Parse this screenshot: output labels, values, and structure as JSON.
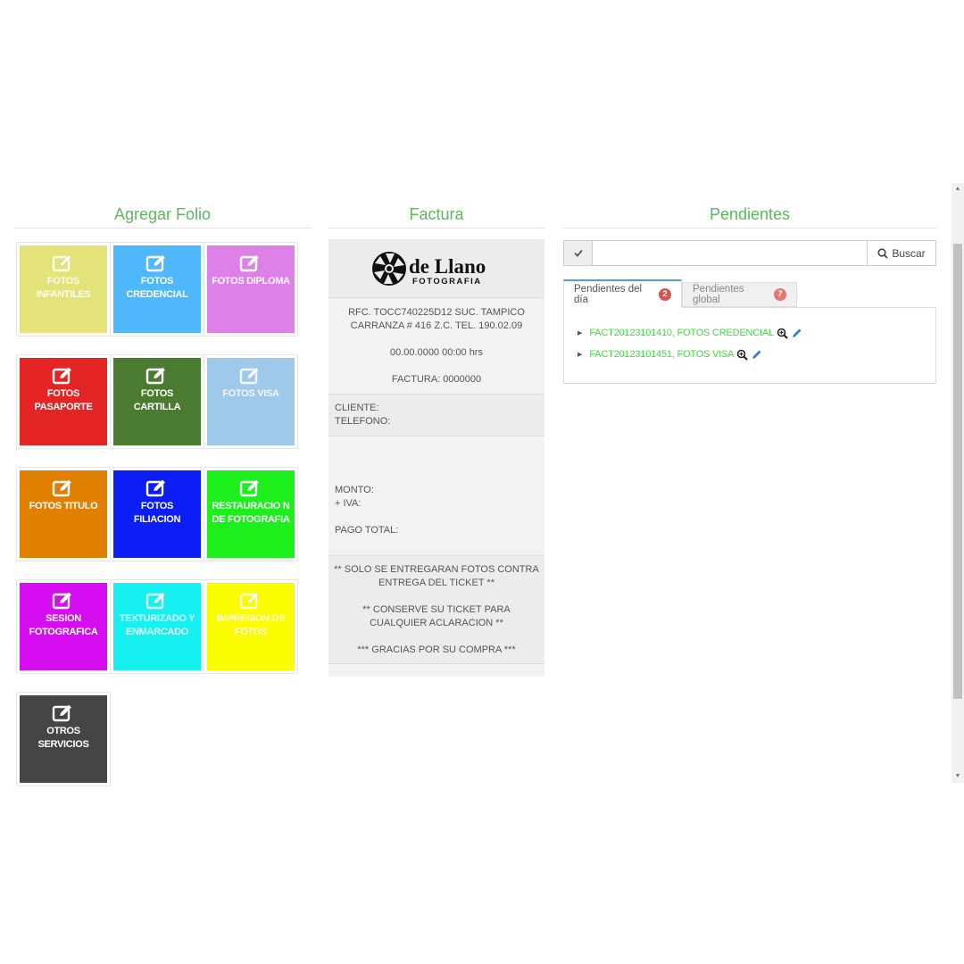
{
  "agregar": {
    "title": "Agregar Folio",
    "tiles": [
      {
        "label": "FOTOS INFANTILES",
        "color": "#e3e37a",
        "faded": true
      },
      {
        "label": "FOTOS CREDENCIAL",
        "color": "#4fb8fa",
        "faded": false
      },
      {
        "label": "FOTOS DIPLOMA",
        "color": "#dd80e8",
        "faded": false
      },
      {
        "label": "FOTOS PASAPORTE",
        "color": "#e52424",
        "faded": false
      },
      {
        "label": "FOTOS CARTILLA",
        "color": "#4b7a31",
        "faded": false
      },
      {
        "label": "FOTOS VISA",
        "color": "#9fc9ea",
        "faded": true
      },
      {
        "label": "FOTOS TITULO",
        "color": "#e07f00",
        "faded": false
      },
      {
        "label": "FOTOS FILIACION",
        "color": "#0b1ef5",
        "faded": false
      },
      {
        "label": "RESTAURACIO N DE FOTOGRAFIA",
        "color": "#1cef1c",
        "faded": false
      },
      {
        "label": "SESION FOTOGRAFICA",
        "color": "#d50df0",
        "faded": false
      },
      {
        "label": "TEXTURIZADO Y ENMARCADO",
        "color": "#17f0f0",
        "faded": true
      },
      {
        "label": "IMPRESION DE FOTOS",
        "color": "#fbfb02",
        "faded": true
      },
      {
        "label": "OTROS SERVICIOS",
        "color": "#454545",
        "faded": false
      }
    ]
  },
  "factura": {
    "title": "Factura",
    "logo_text": "de Llano",
    "logo_sub": "FOTOGRAFIA",
    "rfc_line1": "RFC. TOCC740225D12 SUC. TAMPICO",
    "rfc_line2": "CARRANZA # 416 Z.C. TEL. 190.02.09",
    "datetime": "00.00.0000 00:00 hrs",
    "factura_num": "FACTURA: 0000000",
    "cliente": "CLIENTE:",
    "telefono": "TELEFONO:",
    "monto": "MONTO:",
    "iva": "+ IVA:",
    "pago_total": "PAGO TOTAL:",
    "note1": "** SOLO SE ENTREGARAN FOTOS CONTRA ENTREGA DEL TICKET **",
    "note2": "** CONSERVE SU TICKET PARA CUALQUIER ACLARACION **",
    "note3": "*** GRACIAS POR SU COMPRA ***"
  },
  "pendientes": {
    "title": "Pendientes",
    "search_placeholder": "",
    "search_button": "Buscar",
    "tab_day": "Pendientes del día",
    "tab_day_count": "2",
    "tab_global": "Pendientes global",
    "tab_global_count": "7",
    "items": [
      {
        "label": "FACT20123101410, FOTOS CREDENCIAL"
      },
      {
        "label": "FACT20123101451, FOTOS VISA"
      }
    ]
  },
  "colors": {
    "accent_green": "#5cb85c",
    "link_green": "#3ddc3d",
    "badge_red": "#d9534f",
    "edit_blue": "#3a7bd5"
  }
}
